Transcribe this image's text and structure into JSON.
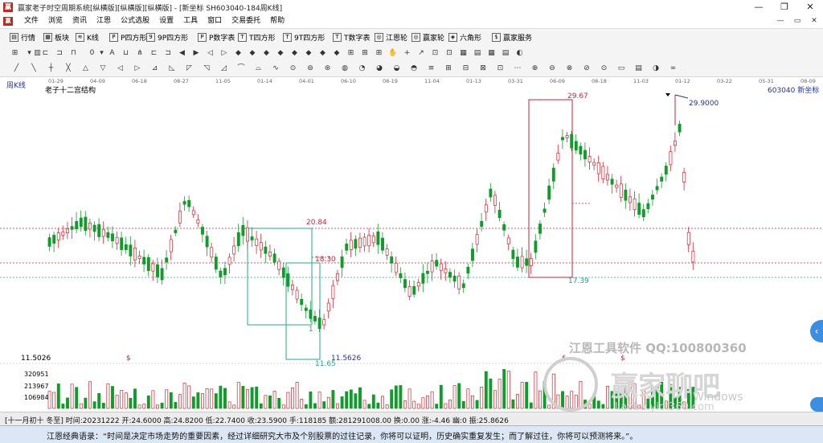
{
  "window": {
    "title": "赢家老子时空周期系统[纵横版][纵横版][纵横版] - [新坐标  SH603040-184周K线]",
    "min_label": "—",
    "max_label": "❐",
    "close_label": "✕"
  },
  "menu": {
    "items": [
      "文件",
      "浏览",
      "资讯",
      "江恩",
      "公式选股",
      "设置",
      "工具",
      "窗口",
      "交易委托",
      "帮助"
    ],
    "mdi_min": "—",
    "mdi_restore": "▭",
    "mdi_close": "✕"
  },
  "toolbar1": [
    "行情",
    "板块",
    "K线",
    "P四方形",
    "9P四方形",
    "P数字表",
    "T四方形",
    "9T四方形",
    "T数字表",
    "江恩轮",
    "赢家轮",
    "六角形",
    "赢家服务"
  ],
  "toolbar2_zero": "0",
  "chart": {
    "period_label": "周K线",
    "indicator_label": "老子十二宫结构",
    "code_label": "603040  新坐标",
    "date_ticks": [
      "01-29",
      "04-09",
      "06-18",
      "08-27",
      "11-05",
      "01-14",
      "04-01",
      "06-10",
      "08-19",
      "11-04",
      "01-13",
      "03-31",
      "06-09",
      "08-18",
      "11-03",
      "01-12",
      "03-22",
      "05-31",
      "08-09"
    ],
    "price_labels": {
      "high1": "29.67",
      "high2": "29.9000",
      "level_2084": "20.84",
      "level_1830": "18.30",
      "level_1739": "17.39",
      "low": "11.65",
      "low_partial": "11.5626",
      "low_partial_prefix": "11",
      "left_low_axis": "11.5026",
      "left_partial": "1"
    },
    "volume_axis": [
      "320951",
      "213967",
      "106984"
    ],
    "dollar_marker": "$",
    "watermark1": "江恩工具软件  QQ:100800360",
    "watermark2": "赢家聊吧",
    "watermark3": "Windows",
    "watermark4": "liaoba.yict360.com"
  },
  "status": {
    "text": "[十一月初十 冬至] 时间:20231222 开:24.6000 高:24.8200 低:22.7400 收:23.5900 手:118185 额:281291008.00 换:0.00 涨:-4.46 幽:0 振:25.8626"
  },
  "quote": {
    "text": "江恩经典语录：“时间是决定市场走势的重要因素，经过详细研究大市及个别股票的过往记录，你将可以证明，历史确实重复发生；而了解过往，你将可以预测将来。”。"
  },
  "colors": {
    "up": "#e0202a",
    "down": "#0f9d2a",
    "accent": "#2233aa"
  }
}
